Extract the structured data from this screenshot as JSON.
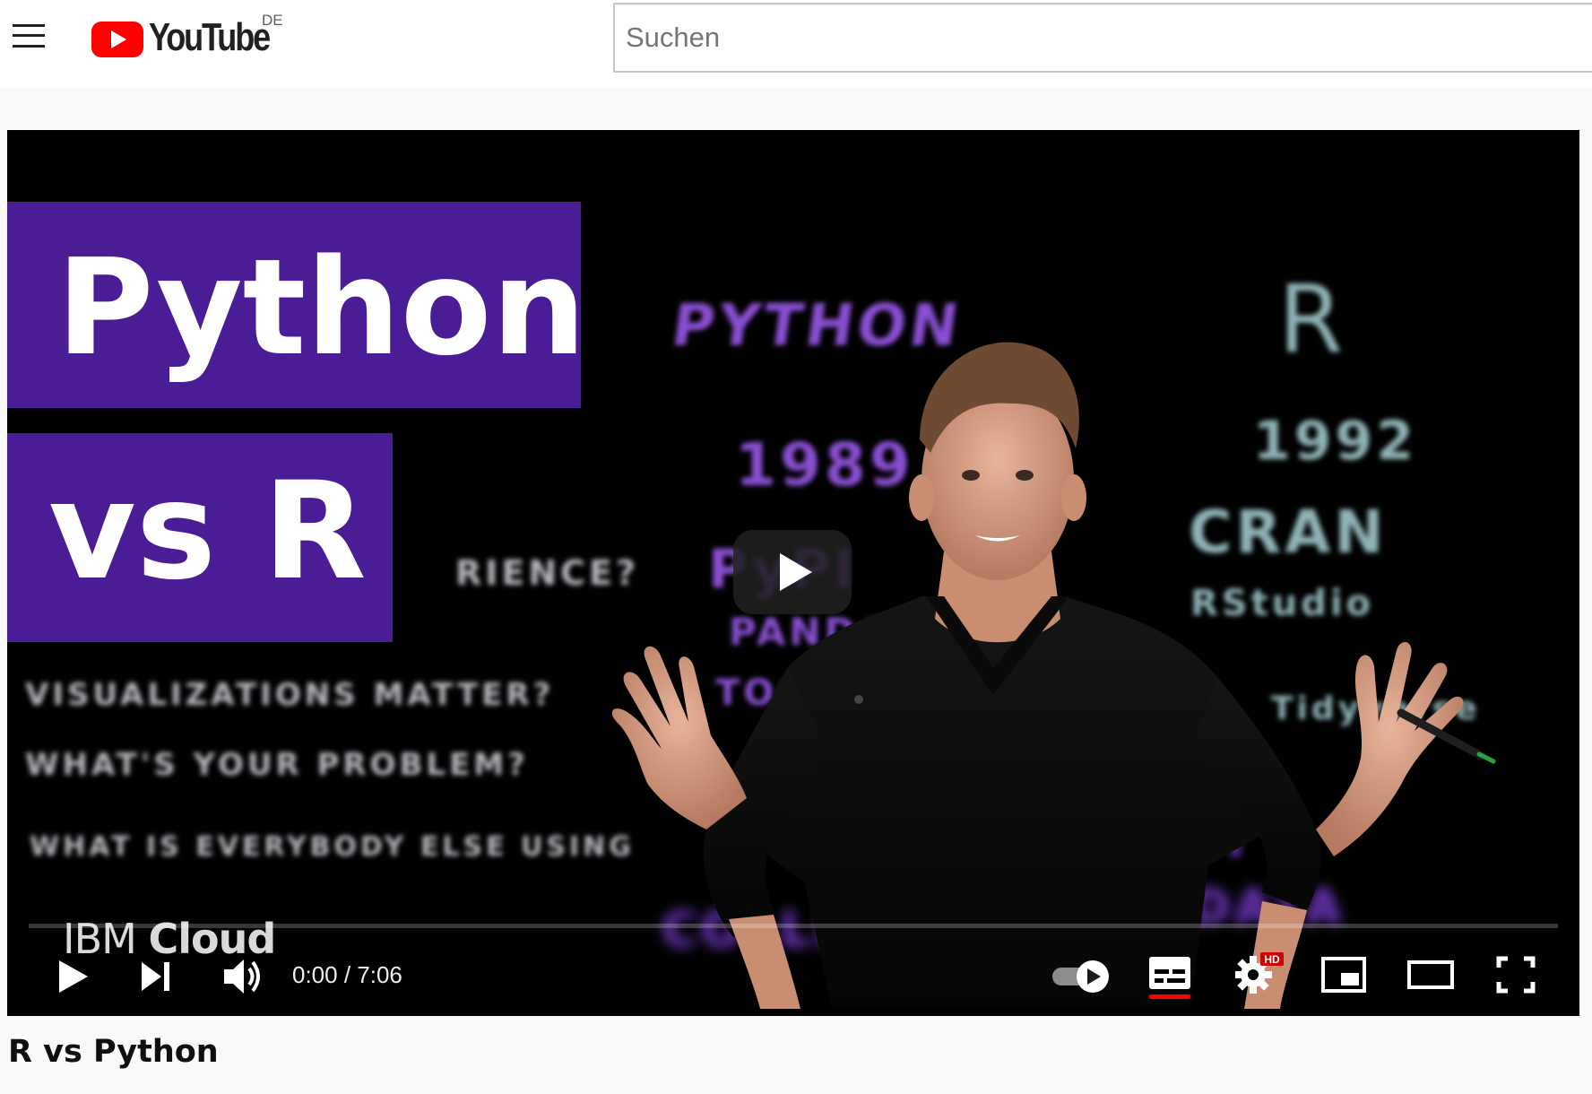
{
  "masthead": {
    "logo_text": "YouTube",
    "country_code": "DE",
    "search_placeholder": "Suchen"
  },
  "player": {
    "thumbnail_title_line1": "Python",
    "thumbnail_title_line2": "vs R",
    "watermark_light": "IBM",
    "watermark_bold": "Cloud",
    "time_current": "0:00",
    "time_separator": " / ",
    "time_duration": "7:06",
    "progress_fraction": 0,
    "settings_badge": "HD",
    "subtitles_enabled": true,
    "autoplay_enabled": true,
    "colors": {
      "accent": "#ff0000",
      "title_band": "#4a1d96"
    }
  },
  "video": {
    "title": "R vs Python"
  }
}
